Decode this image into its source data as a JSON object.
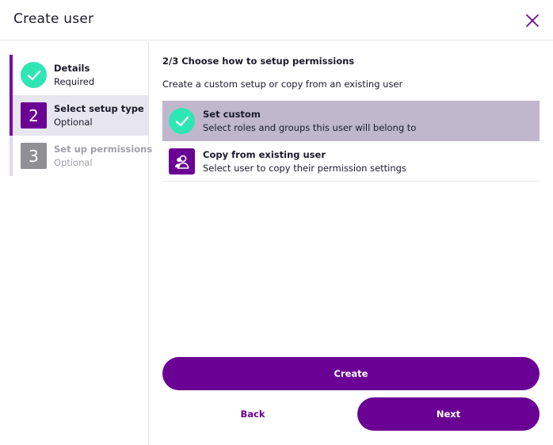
{
  "header": {
    "title": "Create user",
    "close_icon": "close-icon"
  },
  "steps": [
    {
      "name": "Details",
      "status": "Required",
      "state": "completed",
      "icon": "check-icon"
    },
    {
      "number": "2",
      "name": "Select setup type",
      "status": "Optional",
      "state": "active"
    },
    {
      "number": "3",
      "name": "Set up permissions",
      "status": "Optional",
      "state": "disabled"
    }
  ],
  "main": {
    "heading": "2/3 Choose how to setup permissions",
    "intro": "Create a custom setup or copy from an existing user",
    "options": [
      {
        "title": "Set custom",
        "description": "Select roles and groups this user will belong to",
        "selected": true,
        "icon": "check-icon"
      },
      {
        "title": "Copy from existing user",
        "description": "Select user to copy their permission settings",
        "selected": false,
        "icon": "user-copy-icon"
      }
    ]
  },
  "footer": {
    "create_label": "Create",
    "back_label": "Back",
    "next_label": "Next"
  },
  "colors": {
    "brand": "#6a0094",
    "success": "#2ee6b3",
    "selected_bg": "#c0b7cd",
    "active_step_bg": "#e7e6ef",
    "muted": "#8f8f95"
  }
}
